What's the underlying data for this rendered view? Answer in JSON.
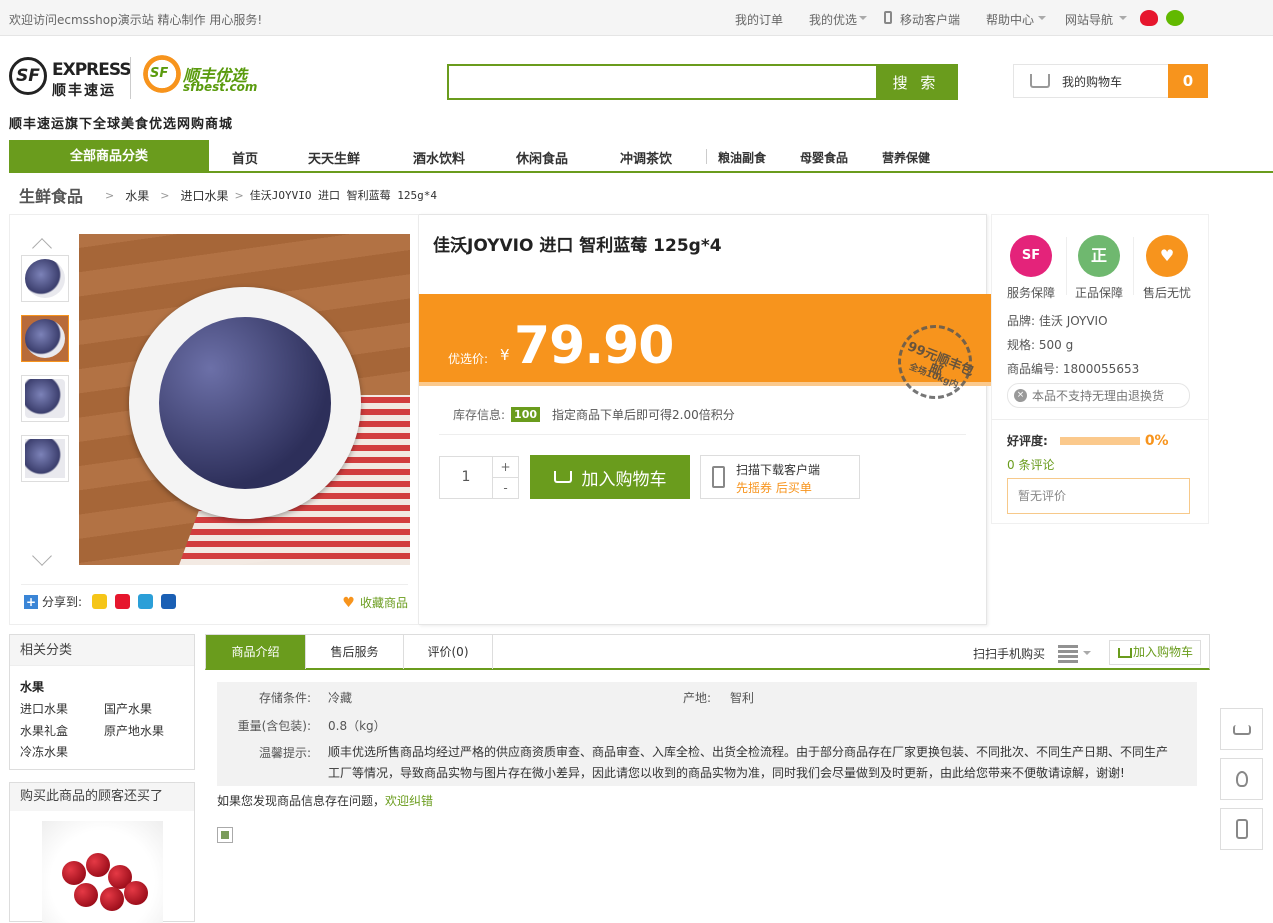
{
  "topbar": {
    "welcome": "欢迎访问ecmsshop演示站 精心制作 用心服务!",
    "links": [
      "我的订单",
      "我的优选",
      "移动客户端",
      "帮助中心",
      "网站导航"
    ]
  },
  "logo": {
    "sf_mark": "SF",
    "sf_express": "EXPRESS",
    "sf_cn": "顺丰速运",
    "sfbest_mark": "SF",
    "sfbest_cn": "顺丰优选",
    "sfbest_url": "sfbest.com",
    "tagline": "顺丰速运旗下全球美食优选网购商城"
  },
  "search": {
    "value": "",
    "button": "搜 索"
  },
  "cart": {
    "label": "我的购物车",
    "count": "0"
  },
  "nav": {
    "all": "全部商品分类",
    "items": [
      "首页",
      "天天生鲜",
      "酒水饮料",
      "休闲食品",
      "冲调茶饮",
      "粮油副食",
      "母婴食品",
      "营养保健"
    ]
  },
  "breadcrumb": {
    "category": "生鲜食品",
    "links": [
      "水果",
      "进口水果"
    ],
    "current": "佳沃JOYVIO 进口 智利蓝莓 125g*4"
  },
  "product": {
    "title": "佳沃JOYVIO 进口 智利蓝莓 125g*4",
    "price_label": "优选价:",
    "currency": "¥",
    "price": "79.90",
    "stamp": "99元顺丰包邮",
    "stamp_sub": "全场10kg内",
    "stock_label": "库存信息:",
    "stock": "100",
    "points_text": "指定商品下单后即可得2.00倍积分",
    "quantity": "1",
    "add_to_cart": "加入购物车",
    "scan_title": "扫描下载客户端",
    "scan_sub": "先摇券 后买单",
    "share_label": "分享到:",
    "favorite": "收藏商品"
  },
  "guarantees": [
    "服务保障",
    "正品保障",
    "售后无忧"
  ],
  "guarantee_icons": [
    "SF",
    "正",
    "♥"
  ],
  "specs": {
    "brand_label": "品牌:",
    "brand": "佳沃 JOYVIO",
    "size_label": "规格:",
    "size": "500 g",
    "sku_label": "商品编号:",
    "sku": "1800055653",
    "no_return": "本品不支持无理由退换货"
  },
  "rating": {
    "label": "好评度:",
    "percent": "0%",
    "percent_value": 0,
    "comments": "0 条评论",
    "empty": "暂无评价"
  },
  "related": {
    "title": "相关分类",
    "main": "水果",
    "items": [
      "进口水果",
      "国产水果",
      "水果礼盒",
      "原产地水果",
      "冷冻水果"
    ]
  },
  "also_bought": {
    "title": "购买此商品的顾客还买了"
  },
  "tabs": {
    "items": [
      "商品介绍",
      "售后服务",
      "评价(0)"
    ],
    "scan_buy": "扫扫手机购买",
    "add_cart": "加入购物车"
  },
  "attributes": {
    "storage_label": "存储条件:",
    "storage": "冷藏",
    "origin_label": "产地:",
    "origin": "智利",
    "weight_label": "重量(含包装):",
    "weight": "0.8（kg）",
    "tip_label": "温馨提示:",
    "tip": "顺丰优选所售商品均经过严格的供应商资质审查、商品审查、入库全检、出货全检流程。由于部分商品存在厂家更换包装、不同批次、不同生产日期、不同生产工厂等情况，导致商品实物与图片存在微小差异，因此请您以收到的商品实物为准，同时我们会尽量做到及时更新，由此给您带来不便敬请谅解，谢谢!"
  },
  "report": {
    "text": "如果您发现商品信息存在问题，",
    "link": "欢迎纠错"
  },
  "colors": {
    "green": "#6a9c1d",
    "orange": "#f7941d",
    "pink": "#e4237a"
  }
}
